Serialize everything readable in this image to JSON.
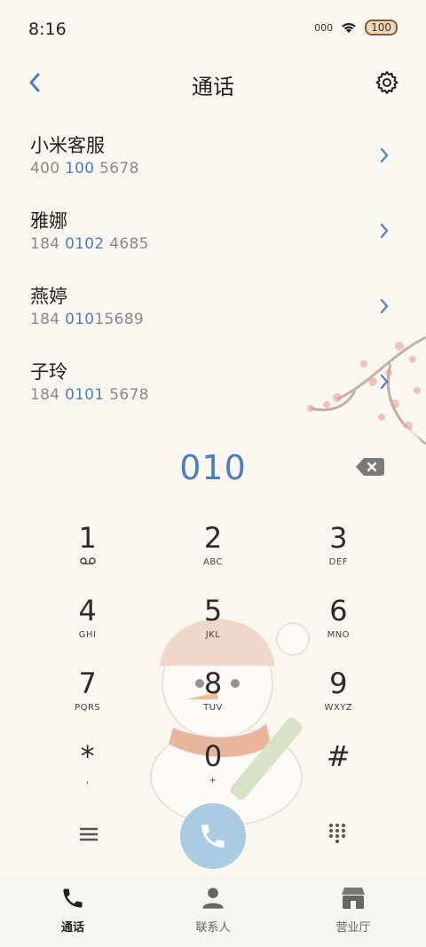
{
  "status_bar": {
    "time": "8:16",
    "signal_text": "000",
    "battery": "100"
  },
  "header": {
    "title": "通话"
  },
  "contacts": [
    {
      "name": "小米客服",
      "num_pre": "400 ",
      "num_hl": "100",
      "num_post": " 5678"
    },
    {
      "name": "雅娜",
      "num_pre": "184 ",
      "num_hl": "0102",
      "num_post": " 4685"
    },
    {
      "name": "燕婷",
      "num_pre": "184 ",
      "num_hl": "010",
      "num_post": "15689"
    },
    {
      "name": "子玲",
      "num_pre": "184 ",
      "num_hl": "0101",
      "num_post": " 5678"
    }
  ],
  "dialer": {
    "input": "010",
    "keys": [
      {
        "digit": "1",
        "letters": ""
      },
      {
        "digit": "2",
        "letters": "ABC"
      },
      {
        "digit": "3",
        "letters": "DEF"
      },
      {
        "digit": "4",
        "letters": "GHI"
      },
      {
        "digit": "5",
        "letters": "JKL"
      },
      {
        "digit": "6",
        "letters": "MNO"
      },
      {
        "digit": "7",
        "letters": "PQRS"
      },
      {
        "digit": "8",
        "letters": "TUV"
      },
      {
        "digit": "9",
        "letters": "WXYZ"
      },
      {
        "digit": "*",
        "letters": ","
      },
      {
        "digit": "0",
        "letters": "+"
      },
      {
        "digit": "#",
        "letters": ""
      }
    ]
  },
  "bottom_nav": [
    {
      "label": "通话",
      "icon": "phone-icon",
      "active": true
    },
    {
      "label": "联系人",
      "icon": "person-icon",
      "active": false
    },
    {
      "label": "营业厅",
      "icon": "store-icon",
      "active": false
    }
  ],
  "colors": {
    "accent": "#4a7fc1",
    "call_button": "#a9cbe3",
    "background": "#faf7f0"
  }
}
